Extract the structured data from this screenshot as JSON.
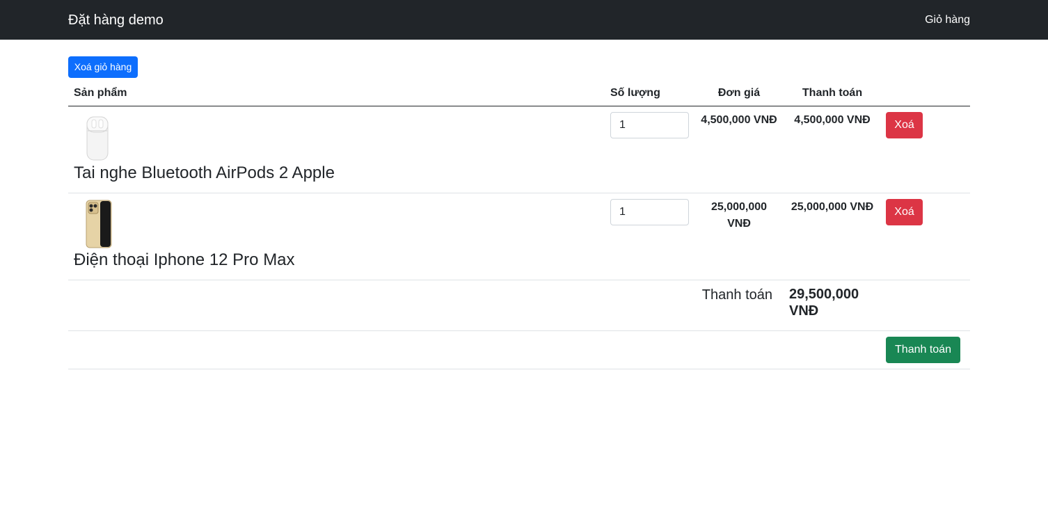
{
  "navbar": {
    "brand": "Đặt hàng demo",
    "cart_link": "Giỏ hàng",
    "bg_color": "#212529"
  },
  "actions": {
    "clear_cart": "Xoá giỏ hàng"
  },
  "table": {
    "headers": {
      "product": "Sản phẩm",
      "quantity": "Số lượng",
      "unit_price": "Đơn giá",
      "payment": "Thanh toán"
    },
    "rows": [
      {
        "name": "Tai nghe Bluetooth AirPods 2 Apple",
        "image_icon": "airpods-image",
        "quantity": "1",
        "unit_price": "4,500,000 VNĐ",
        "total": "4,500,000 VNĐ",
        "delete_label": "Xoá"
      },
      {
        "name": "Điện thoại Iphone 12 Pro Max",
        "image_icon": "iphone-image",
        "quantity": "1",
        "unit_price": "25,000,000 VNĐ",
        "total": "25,000,000 VNĐ",
        "delete_label": "Xoá"
      }
    ]
  },
  "summary": {
    "label": "Thanh toán",
    "value": "29,500,000 VNĐ"
  },
  "checkout": {
    "label": "Thanh toán"
  },
  "colors": {
    "primary": "#0d6efd",
    "danger": "#dc3545",
    "success": "#198754"
  }
}
